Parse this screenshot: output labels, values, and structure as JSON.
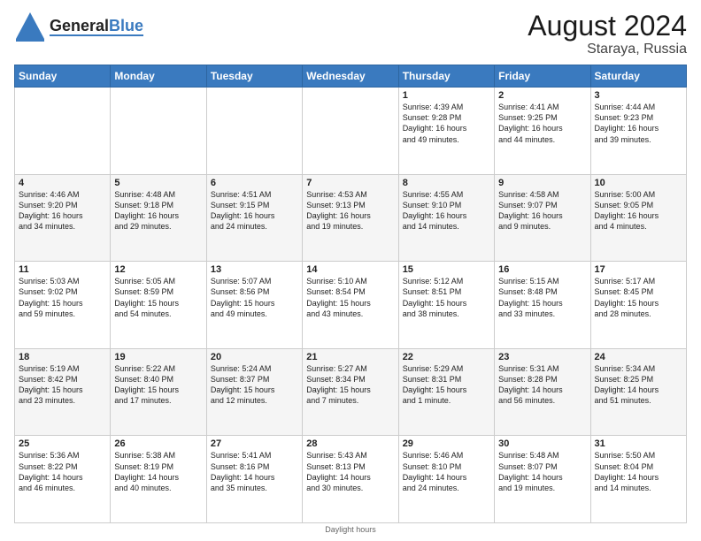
{
  "header": {
    "logo": {
      "general": "General",
      "blue": "Blue"
    },
    "title": "August 2024",
    "location": "Staraya, Russia"
  },
  "days_of_week": [
    "Sunday",
    "Monday",
    "Tuesday",
    "Wednesday",
    "Thursday",
    "Friday",
    "Saturday"
  ],
  "weeks": [
    [
      {
        "day": "",
        "info": ""
      },
      {
        "day": "",
        "info": ""
      },
      {
        "day": "",
        "info": ""
      },
      {
        "day": "",
        "info": ""
      },
      {
        "day": "1",
        "info": "Sunrise: 4:39 AM\nSunset: 9:28 PM\nDaylight: 16 hours\nand 49 minutes."
      },
      {
        "day": "2",
        "info": "Sunrise: 4:41 AM\nSunset: 9:25 PM\nDaylight: 16 hours\nand 44 minutes."
      },
      {
        "day": "3",
        "info": "Sunrise: 4:44 AM\nSunset: 9:23 PM\nDaylight: 16 hours\nand 39 minutes."
      }
    ],
    [
      {
        "day": "4",
        "info": "Sunrise: 4:46 AM\nSunset: 9:20 PM\nDaylight: 16 hours\nand 34 minutes."
      },
      {
        "day": "5",
        "info": "Sunrise: 4:48 AM\nSunset: 9:18 PM\nDaylight: 16 hours\nand 29 minutes."
      },
      {
        "day": "6",
        "info": "Sunrise: 4:51 AM\nSunset: 9:15 PM\nDaylight: 16 hours\nand 24 minutes."
      },
      {
        "day": "7",
        "info": "Sunrise: 4:53 AM\nSunset: 9:13 PM\nDaylight: 16 hours\nand 19 minutes."
      },
      {
        "day": "8",
        "info": "Sunrise: 4:55 AM\nSunset: 9:10 PM\nDaylight: 16 hours\nand 14 minutes."
      },
      {
        "day": "9",
        "info": "Sunrise: 4:58 AM\nSunset: 9:07 PM\nDaylight: 16 hours\nand 9 minutes."
      },
      {
        "day": "10",
        "info": "Sunrise: 5:00 AM\nSunset: 9:05 PM\nDaylight: 16 hours\nand 4 minutes."
      }
    ],
    [
      {
        "day": "11",
        "info": "Sunrise: 5:03 AM\nSunset: 9:02 PM\nDaylight: 15 hours\nand 59 minutes."
      },
      {
        "day": "12",
        "info": "Sunrise: 5:05 AM\nSunset: 8:59 PM\nDaylight: 15 hours\nand 54 minutes."
      },
      {
        "day": "13",
        "info": "Sunrise: 5:07 AM\nSunset: 8:56 PM\nDaylight: 15 hours\nand 49 minutes."
      },
      {
        "day": "14",
        "info": "Sunrise: 5:10 AM\nSunset: 8:54 PM\nDaylight: 15 hours\nand 43 minutes."
      },
      {
        "day": "15",
        "info": "Sunrise: 5:12 AM\nSunset: 8:51 PM\nDaylight: 15 hours\nand 38 minutes."
      },
      {
        "day": "16",
        "info": "Sunrise: 5:15 AM\nSunset: 8:48 PM\nDaylight: 15 hours\nand 33 minutes."
      },
      {
        "day": "17",
        "info": "Sunrise: 5:17 AM\nSunset: 8:45 PM\nDaylight: 15 hours\nand 28 minutes."
      }
    ],
    [
      {
        "day": "18",
        "info": "Sunrise: 5:19 AM\nSunset: 8:42 PM\nDaylight: 15 hours\nand 23 minutes."
      },
      {
        "day": "19",
        "info": "Sunrise: 5:22 AM\nSunset: 8:40 PM\nDaylight: 15 hours\nand 17 minutes."
      },
      {
        "day": "20",
        "info": "Sunrise: 5:24 AM\nSunset: 8:37 PM\nDaylight: 15 hours\nand 12 minutes."
      },
      {
        "day": "21",
        "info": "Sunrise: 5:27 AM\nSunset: 8:34 PM\nDaylight: 15 hours\nand 7 minutes."
      },
      {
        "day": "22",
        "info": "Sunrise: 5:29 AM\nSunset: 8:31 PM\nDaylight: 15 hours\nand 1 minute."
      },
      {
        "day": "23",
        "info": "Sunrise: 5:31 AM\nSunset: 8:28 PM\nDaylight: 14 hours\nand 56 minutes."
      },
      {
        "day": "24",
        "info": "Sunrise: 5:34 AM\nSunset: 8:25 PM\nDaylight: 14 hours\nand 51 minutes."
      }
    ],
    [
      {
        "day": "25",
        "info": "Sunrise: 5:36 AM\nSunset: 8:22 PM\nDaylight: 14 hours\nand 46 minutes."
      },
      {
        "day": "26",
        "info": "Sunrise: 5:38 AM\nSunset: 8:19 PM\nDaylight: 14 hours\nand 40 minutes."
      },
      {
        "day": "27",
        "info": "Sunrise: 5:41 AM\nSunset: 8:16 PM\nDaylight: 14 hours\nand 35 minutes."
      },
      {
        "day": "28",
        "info": "Sunrise: 5:43 AM\nSunset: 8:13 PM\nDaylight: 14 hours\nand 30 minutes."
      },
      {
        "day": "29",
        "info": "Sunrise: 5:46 AM\nSunset: 8:10 PM\nDaylight: 14 hours\nand 24 minutes."
      },
      {
        "day": "30",
        "info": "Sunrise: 5:48 AM\nSunset: 8:07 PM\nDaylight: 14 hours\nand 19 minutes."
      },
      {
        "day": "31",
        "info": "Sunrise: 5:50 AM\nSunset: 8:04 PM\nDaylight: 14 hours\nand 14 minutes."
      }
    ]
  ],
  "footer": {
    "daylight_label": "Daylight hours"
  }
}
